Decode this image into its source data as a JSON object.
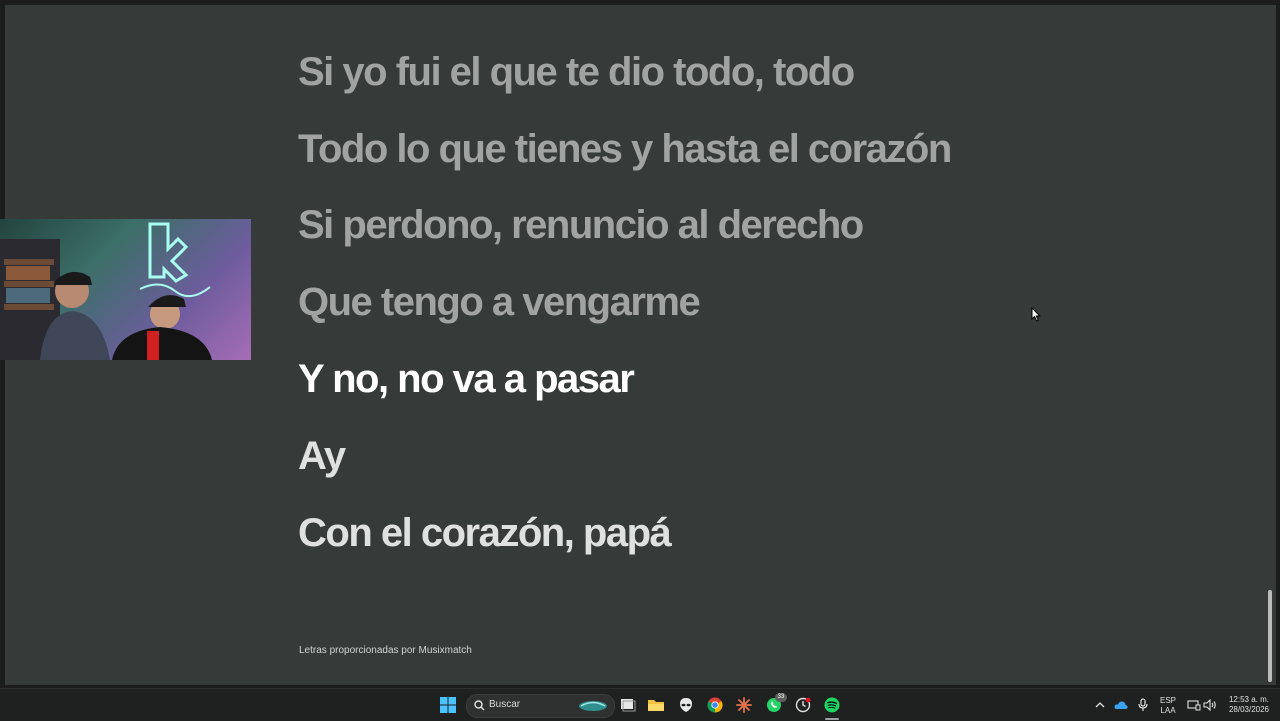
{
  "lyrics": [
    {
      "text": "Si yo fui el que te dio todo, todo",
      "state": "past"
    },
    {
      "text": "Todo lo que tienes y hasta el corazón",
      "state": "past"
    },
    {
      "text": "Si perdono, renuncio al derecho",
      "state": "past"
    },
    {
      "text": "Que tengo a vengarme",
      "state": "past"
    },
    {
      "text": "Y no, no va a pasar",
      "state": "active"
    },
    {
      "text": "Ay",
      "state": "upcoming"
    },
    {
      "text": "Con el corazón, papá",
      "state": "upcoming"
    }
  ],
  "credit": "Letras proporcionadas por Musixmatch",
  "taskbar": {
    "search_label": "Buscar",
    "whatsapp_badge": "33",
    "language": "ESP",
    "keyboard": "LAA",
    "time": "12:53 a. m.",
    "date": "28/03/2026",
    "pinned_apps": [
      "windows-start-icon",
      "task-view-icon",
      "file-explorer-icon",
      "alien-app-icon",
      "chrome-icon",
      "starburst-app-icon",
      "whatsapp-icon",
      "clock-app-icon",
      "spotify-icon"
    ]
  },
  "colors": {
    "panel": "#363a39",
    "lyric_past": "#a0a3a2",
    "lyric_active": "#ffffff",
    "lyric_upcoming": "#dfe1e0",
    "spotify_green": "#1ed760"
  }
}
